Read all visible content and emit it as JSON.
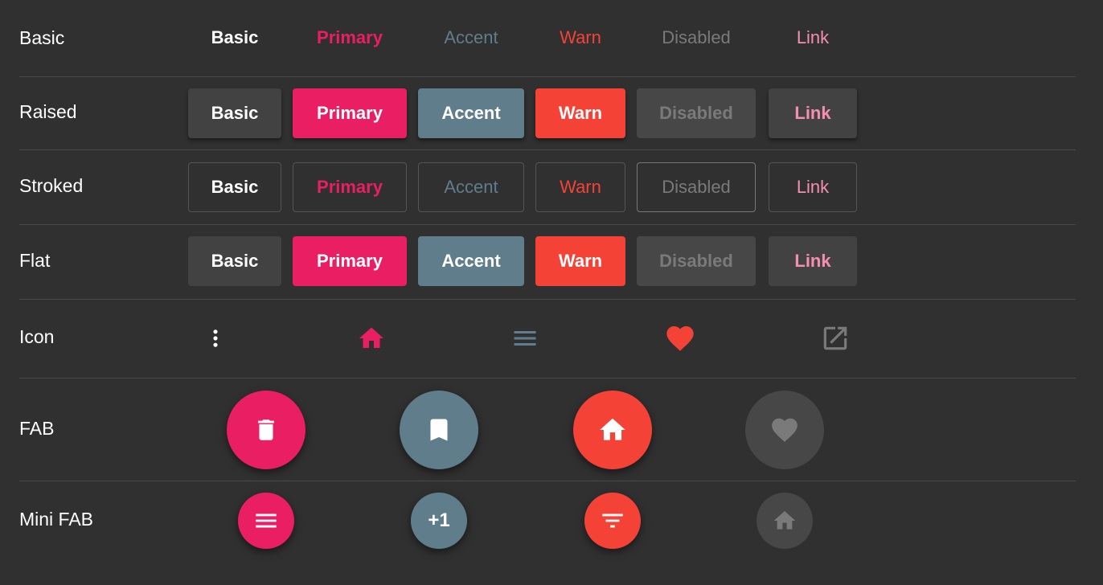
{
  "colors": {
    "background": "#303030",
    "primary": "#e91e63",
    "accent": "#607d8b",
    "warn": "#f44336",
    "disabled_bg": "#474747",
    "disabled_text": "#7a7a7a",
    "link": "#f48fb1",
    "basic_bg": "#424242"
  },
  "rows": {
    "basic": "Basic",
    "raised": "Raised",
    "stroked": "Stroked",
    "flat": "Flat",
    "icon": "Icon",
    "fab": "FAB",
    "mini_fab": "Mini FAB"
  },
  "buttons": {
    "basic": "Basic",
    "primary": "Primary",
    "accent": "Accent",
    "warn": "Warn",
    "disabled": "Disabled",
    "link": "Link"
  },
  "icon_row": [
    "more-vert-icon",
    "home-icon",
    "menu-icon",
    "favorite-icon",
    "open-in-new-icon"
  ],
  "fab_row": [
    "delete-icon",
    "bookmark-icon",
    "home-icon",
    "favorite-icon"
  ],
  "mini_fab_row": {
    "icons": [
      "menu-icon",
      "plus-one",
      "filter-list-icon",
      "home-icon"
    ],
    "plus_one_label": "+1"
  }
}
